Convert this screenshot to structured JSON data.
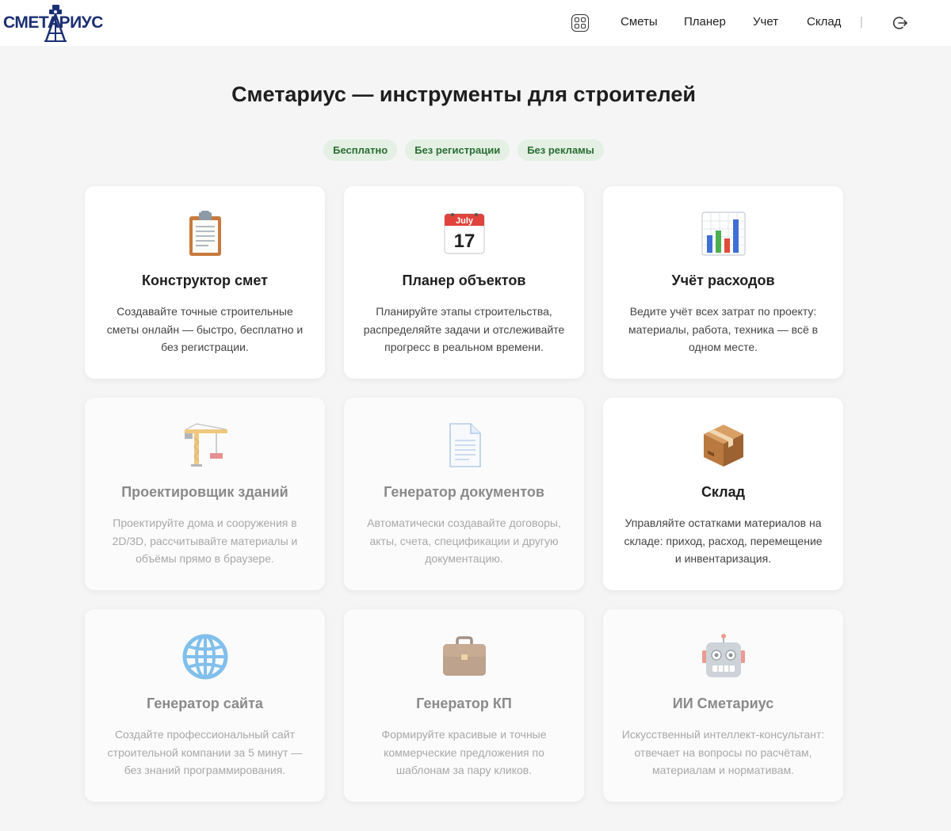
{
  "header": {
    "logo_text": "СМЕТАРИУС",
    "nav": [
      {
        "label": "Сметы"
      },
      {
        "label": "Планер"
      },
      {
        "label": "Учет"
      },
      {
        "label": "Склад"
      }
    ],
    "separator": "|"
  },
  "main": {
    "title": "Сметариус — инструменты для строителей",
    "badges": [
      "Бесплатно",
      "Без регистрации",
      "Без рекламы"
    ],
    "cards": [
      {
        "icon": "clipboard-icon",
        "title": "Конструктор смет",
        "desc": "Создавайте точные строительные сметы онлайн — быстро, бесплатно и без регистрации.",
        "active": true
      },
      {
        "icon": "calendar-icon",
        "title": "Планер объектов",
        "desc": "Планируйте этапы строительства, распределяйте задачи и отслеживайте прогресс в реальном времени.",
        "active": true,
        "calendar_month": "July",
        "calendar_day": "17"
      },
      {
        "icon": "bar-chart-icon",
        "title": "Учёт расходов",
        "desc": "Ведите учёт всех затрат по проекту: материалы, работа, техника — всё в одном месте.",
        "active": true
      },
      {
        "icon": "crane-icon",
        "title": "Проектировщик зданий",
        "desc": "Проектируйте дома и сооружения в 2D/3D, рассчитывайте материалы и объёмы прямо в браузере.",
        "active": false
      },
      {
        "icon": "document-icon",
        "title": "Генератор документов",
        "desc": "Автоматически создавайте договоры, акты, счета, спецификации и другую документацию.",
        "active": false
      },
      {
        "icon": "package-icon",
        "title": "Склад",
        "desc": "Управляйте остатками материалов на складе: приход, расход, перемещение и инвентаризация.",
        "active": true
      },
      {
        "icon": "globe-icon",
        "title": "Генератор сайта",
        "desc": "Создайте профессиональный сайт строительной компании за 5 минут — без знаний программирования.",
        "active": false
      },
      {
        "icon": "briefcase-icon",
        "title": "Генератор КП",
        "desc": "Формируйте красивые и точные коммерческие предложения по шаблонам за пару кликов.",
        "active": false
      },
      {
        "icon": "robot-icon",
        "title": "ИИ Сметариус",
        "desc": "Искусственный интеллект-консультант: отвечает на вопросы по расчётам, материалам и нормативам.",
        "active": false
      }
    ]
  },
  "colors": {
    "brand": "#1b2f73",
    "badge_bg": "#e3f0e3",
    "badge_text": "#2b6d33",
    "page_bg": "#f5f5f6"
  }
}
